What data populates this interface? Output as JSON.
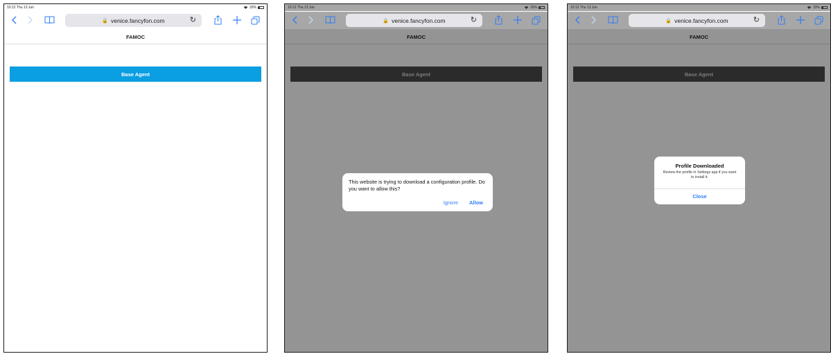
{
  "status_bar": {
    "time": "10:12",
    "date": "Thu 13 Jun",
    "battery": "33%",
    "battery_fraction": 0.33
  },
  "browser": {
    "url": "venice.fancyfon.com"
  },
  "page": {
    "header": "FAMOC",
    "button_label": "Base Agent"
  },
  "download_prompt": {
    "message": "This website is trying to download a configuration profile. Do you want to allow this?",
    "ignore_label": "Ignore",
    "allow_label": "Allow"
  },
  "profile_alert": {
    "title": "Profile Downloaded",
    "message": "Review the profile in Settings app if you want to install it.",
    "close_label": "Close"
  },
  "icons": [
    "back-icon",
    "forward-icon",
    "bookmarks-icon",
    "lock-icon",
    "reload-icon",
    "share-icon",
    "add-tab-icon",
    "tabs-icon",
    "wifi-icon",
    "battery-icon"
  ],
  "colors": {
    "accent": "#2f7cf6",
    "agent_button": "#0a9ee2"
  }
}
